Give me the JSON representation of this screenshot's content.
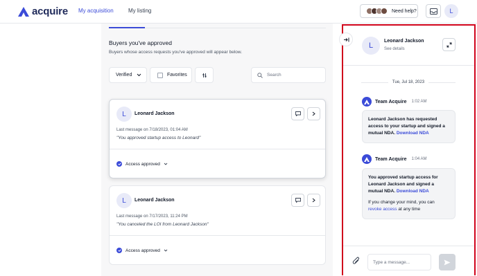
{
  "topbar": {
    "logo_text": "acquire",
    "nav": [
      "My acquisition",
      "My listing"
    ],
    "help_label": "Need help?",
    "user_initial": "L",
    "brand_color": "#3b4bd8"
  },
  "main": {
    "section_title": "Buyers you've approved",
    "section_subtitle": "Buyers whose access requests you've approved will appear below.",
    "filter_verified": "Verified",
    "filter_favorites": "Favorites",
    "search_placeholder": "Search",
    "cards": [
      {
        "initial": "L",
        "name": "Leonard Jackson",
        "meta": "Last message on 7/18/2023, 01:04 AM",
        "quote": "\"You approved startup access to Leonard\"",
        "status": "Access approved"
      },
      {
        "initial": "L",
        "name": "Leonard Jackson",
        "meta": "Last message on 7/17/2023, 11:24 PM",
        "quote": "\"You canceled the LOI from Leonard Jackson\"",
        "status": "Access approved"
      }
    ]
  },
  "panel": {
    "initial": "L",
    "name": "Leonard Jackson",
    "see_details": "See details",
    "date": "Tue, Jul 18, 2023",
    "messages": [
      {
        "sender": "Team Acquire",
        "time": "1:02 AM",
        "text": "Leonard Jackson has requested access to your startup and signed a mutual NDA.",
        "link": "Download NDA"
      },
      {
        "sender": "Team Acquire",
        "time": "1:04 AM",
        "text": "You approved startup access for Leonard Jackson and signed a mutual NDA.",
        "link": "Download NDA",
        "note_before": "If you change your mind, you can",
        "note_link": "revoke access",
        "note_after": "at any time"
      }
    ],
    "input_placeholder": "Type a message..."
  }
}
